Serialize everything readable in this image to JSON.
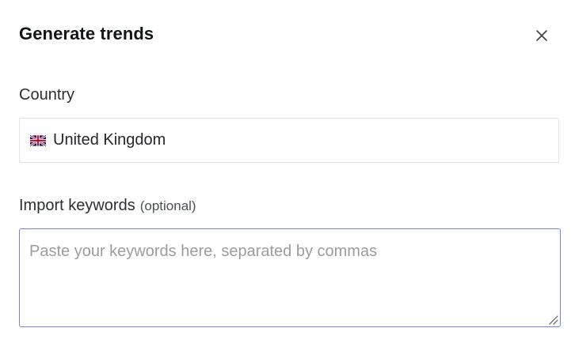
{
  "dialog": {
    "title": "Generate trends",
    "close_icon": "close-icon"
  },
  "country": {
    "label": "Country",
    "flag_icon": "uk-flag-icon",
    "value": "United Kingdom"
  },
  "keywords": {
    "label": "Import keywords",
    "optional_hint": "(optional)",
    "placeholder": "Paste your keywords here, separated by commas",
    "value": ""
  },
  "colors": {
    "focus_border": "#7b7fe0",
    "placeholder": "#9a9ca1"
  }
}
